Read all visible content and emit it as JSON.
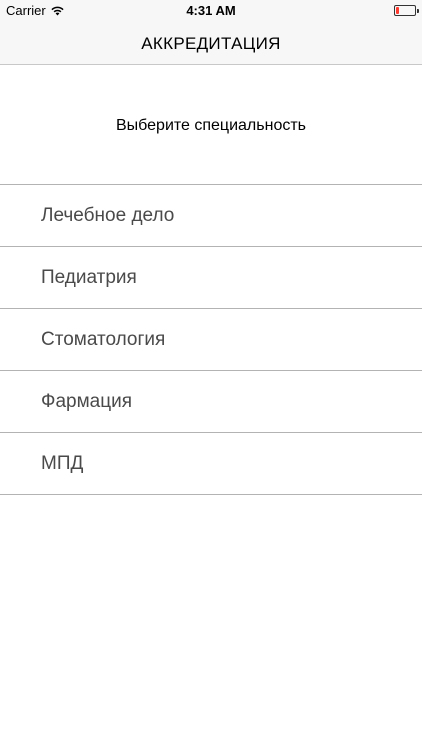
{
  "status_bar": {
    "carrier": "Carrier",
    "time": "4:31 AM",
    "battery_level": 0.15,
    "battery_color": "#ff3b30",
    "signal_icon": "wifi-icon"
  },
  "nav": {
    "title": "АККРЕДИТАЦИЯ"
  },
  "prompt": "Выберите специальность",
  "specialties": [
    {
      "label": "Лечебное дело"
    },
    {
      "label": "Педиатрия"
    },
    {
      "label": "Стоматология"
    },
    {
      "label": "Фармация"
    },
    {
      "label": "МПД"
    }
  ]
}
